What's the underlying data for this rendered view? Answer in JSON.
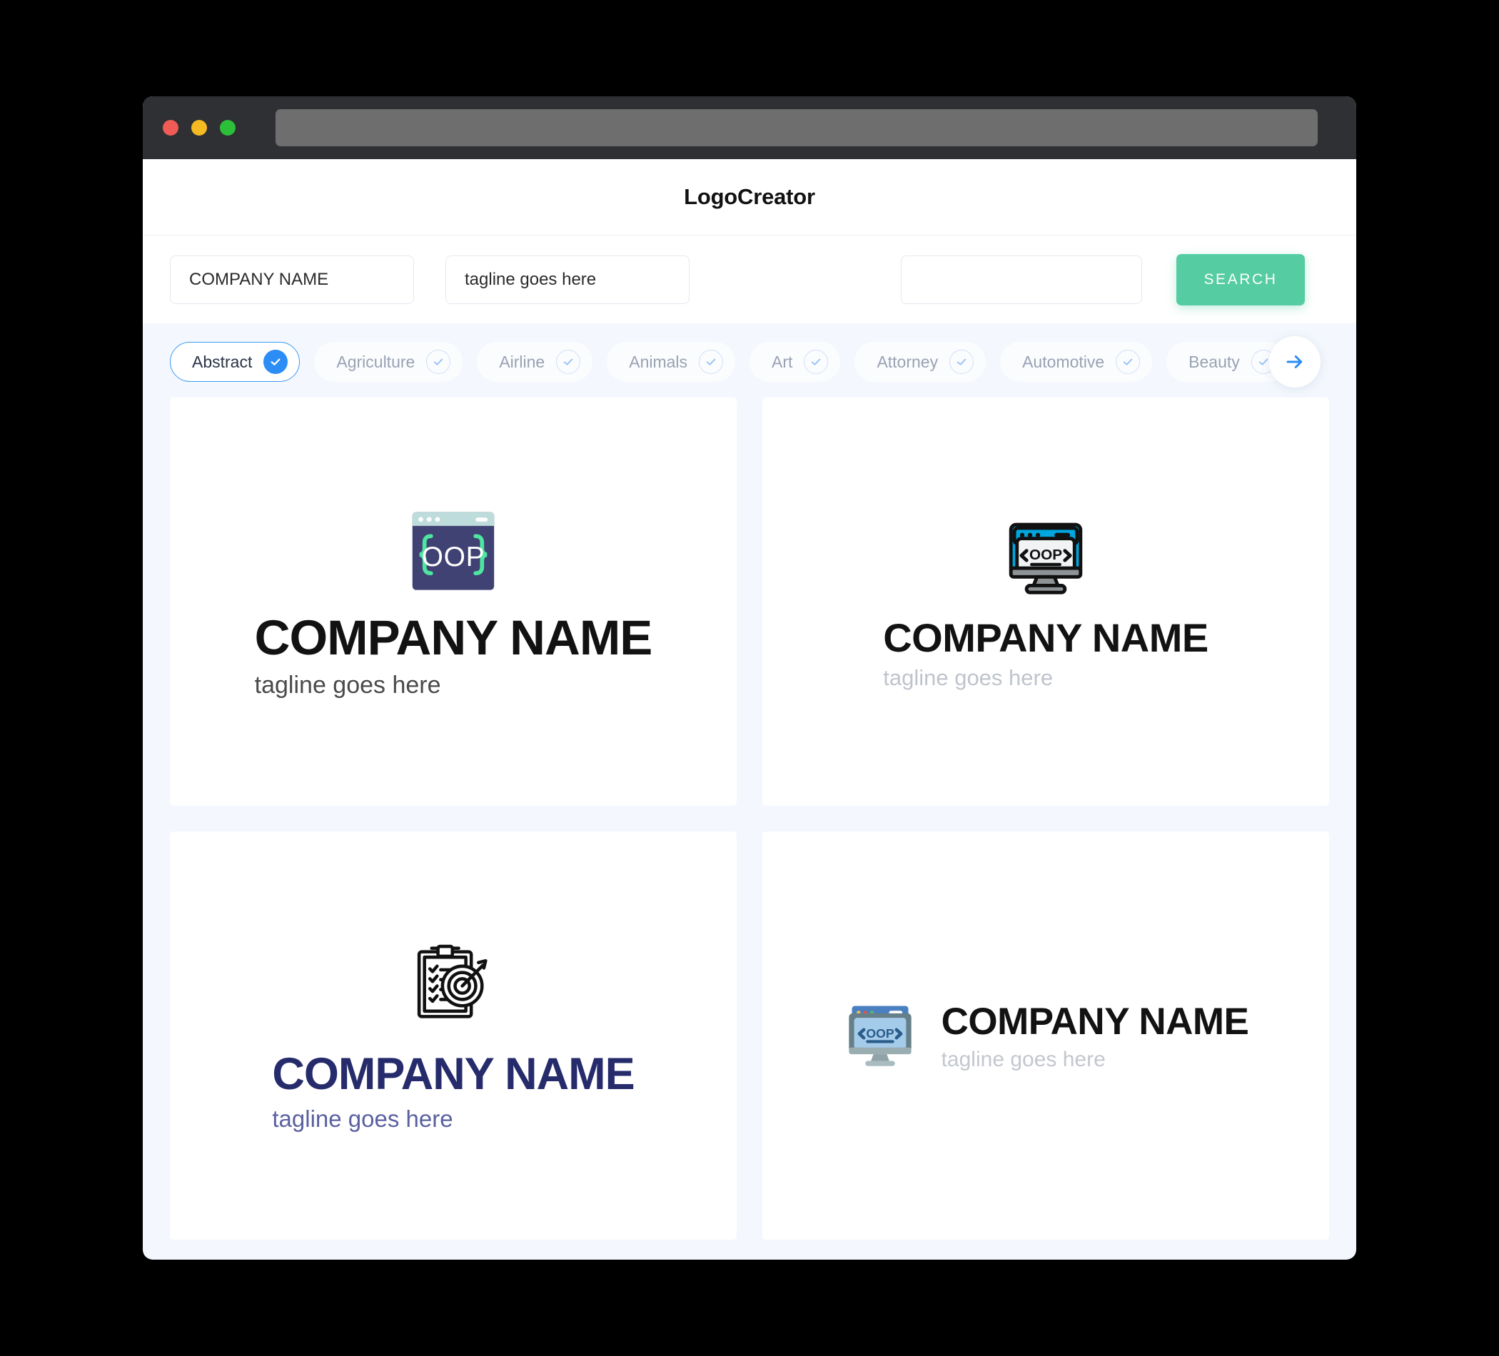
{
  "window": {
    "url_value": "",
    "traffic_lights": [
      "close-red",
      "minimize-yellow",
      "maximize-green"
    ]
  },
  "header": {
    "title": "LogoCreator"
  },
  "search": {
    "company_value": "COMPANY NAME",
    "company_placeholder": "COMPANY NAME",
    "tagline_value": "tagline goes here",
    "tagline_placeholder": "tagline goes here",
    "extra_value": "",
    "extra_placeholder": "",
    "button_label": "SEARCH",
    "button_color": "#55CCA2"
  },
  "categories": {
    "accent_color": "#2B8DF5",
    "next_label": "→",
    "items": [
      {
        "label": "Abstract",
        "selected": true
      },
      {
        "label": "Agriculture",
        "selected": false
      },
      {
        "label": "Airline",
        "selected": false
      },
      {
        "label": "Animals",
        "selected": false
      },
      {
        "label": "Art",
        "selected": false
      },
      {
        "label": "Attorney",
        "selected": false
      },
      {
        "label": "Automotive",
        "selected": false
      },
      {
        "label": "Beauty",
        "selected": false
      }
    ]
  },
  "results": [
    {
      "icon": "browser-window-oop-icon",
      "name": "COMPANY NAME",
      "tagline": "tagline goes here",
      "name_color": "#121212",
      "tagline_color": "#4A4A4A",
      "layout": "stacked"
    },
    {
      "icon": "monitor-oop-icon",
      "name": "COMPANY NAME",
      "tagline": "tagline goes here",
      "name_color": "#121212",
      "tagline_color": "#BFC4CC",
      "layout": "stacked"
    },
    {
      "icon": "clipboard-target-icon",
      "name": "COMPANY NAME",
      "tagline": "tagline goes here",
      "name_color": "#262B6B",
      "tagline_color": "#5B61A0",
      "layout": "stacked"
    },
    {
      "icon": "flat-monitor-oop-icon",
      "name": "COMPANY NAME",
      "tagline": "tagline goes here",
      "name_color": "#121212",
      "tagline_color": "#C3C7CE",
      "layout": "horizontal"
    }
  ]
}
